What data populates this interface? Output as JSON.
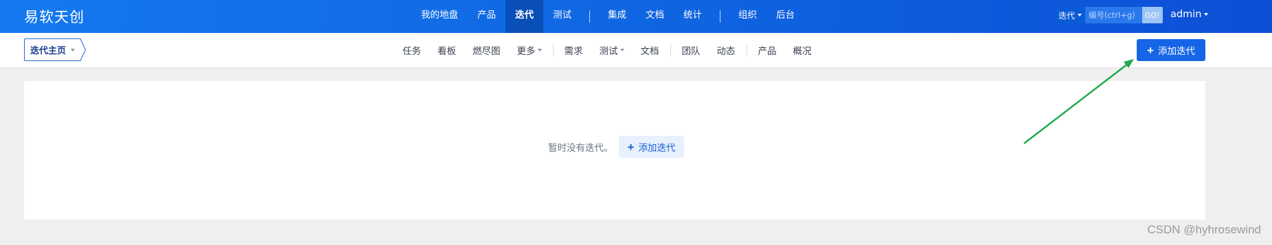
{
  "header": {
    "brand": "易软天创",
    "nav": [
      {
        "label": "我的地盘"
      },
      {
        "label": "产品"
      },
      {
        "label": "迭代",
        "active": true
      },
      {
        "label": "测试"
      },
      {
        "label": "集成"
      },
      {
        "label": "文档"
      },
      {
        "label": "统计"
      },
      {
        "label": "组织"
      },
      {
        "label": "后台"
      }
    ],
    "search": {
      "type_label": "迭代",
      "placeholder": "编号(ctrl+g)",
      "go_label": "GO!"
    },
    "user": "admin",
    "colors": {
      "bar_start": "#1479f0",
      "bar_end": "#0d4fd6",
      "active_tab": "#0a4fb8"
    }
  },
  "subheader": {
    "breadcrumb": "迭代主页",
    "nav": [
      {
        "label": "任务"
      },
      {
        "label": "看板"
      },
      {
        "label": "燃尽图"
      },
      {
        "label": "更多",
        "dropdown": true
      },
      {
        "label": "需求"
      },
      {
        "label": "测试",
        "dropdown": true
      },
      {
        "label": "文档"
      },
      {
        "label": "团队"
      },
      {
        "label": "动态"
      },
      {
        "label": "产品"
      },
      {
        "label": "概况"
      }
    ],
    "add_button": "添加迭代",
    "accent": "#1565e6"
  },
  "main": {
    "empty_text": "暂时没有迭代。",
    "add_button": "添加迭代"
  },
  "annotation": {
    "arrow_color": "#1faa4b",
    "icon": "arrow-annotation"
  },
  "watermark": "CSDN @hyhrosewind"
}
